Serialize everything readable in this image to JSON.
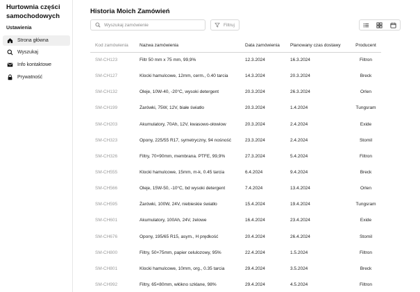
{
  "sidebar": {
    "brand": "Hurtownia części samochodowych",
    "section_label": "Ustawienia",
    "items": [
      {
        "label": "Strona główna",
        "icon": "home-icon",
        "active": true
      },
      {
        "label": "Wyszukaj",
        "icon": "search-icon",
        "active": false
      },
      {
        "label": "Info kontaktowe",
        "icon": "mail-icon",
        "active": false
      },
      {
        "label": "Prywatność",
        "icon": "lock-icon",
        "active": false
      }
    ]
  },
  "header": {
    "title": "Historia Moich Zamówień"
  },
  "search": {
    "placeholder": "Wyszukaj zamówienie",
    "value": ""
  },
  "filter": {
    "label": "Filtruj"
  },
  "view_toggle": [
    "list-view-icon",
    "grid-view-icon",
    "calendar-view-icon"
  ],
  "table": {
    "columns": [
      "Kod zamówienia",
      "Nazwa zamówienia",
      "Data zamówienia",
      "Planowany czas dostawy",
      "Producent"
    ],
    "rows": [
      [
        "SM-CH123",
        "Filtr 50 mm x 75 mm,  99,9%",
        "12.3.2024",
        "16.3.2024",
        "Filtron"
      ],
      [
        "SM-CH127",
        "Klocki hamulcowe, 12mm, cerm., 0.40 tarcia",
        "14.3.2024",
        "20.3.2024",
        "Breck"
      ],
      [
        "SM-CH132",
        "Oleje, 10W-40, -20°C, wysoki detergent",
        "20.3.2024",
        "26.3.2024",
        "Orlen"
      ],
      [
        "SM-CH199",
        "Żarówki, 75W, 12V, białe światło",
        "20.3.2024",
        "1.4.2024",
        "Tungsram"
      ],
      [
        "SM-CH203",
        "Akumulatory, 70Ah, 12V, kwasowo-ołowiow",
        "20.3.2024",
        "2.4.2024",
        "Exide"
      ],
      [
        "SM-CH323",
        "Opony, 225/55 R17, symetryczny, 94 nośność",
        "23.3.2024",
        "2.4.2024",
        "Stomil"
      ],
      [
        "SM-CH326",
        "Filtry, 70×90mm, membrana. PTFE, 99,9%",
        "27.3.2024",
        "5.4.2024",
        "Filtron"
      ],
      [
        "SM-CH555",
        "Klocki hamulcowe, 15mm, m-k, 0.45 tarcia",
        "6.4.2024",
        "9.4.2024",
        "Breck"
      ],
      [
        "SM-CH566",
        "Oleje, 15W-50, -10°C, bd wysoki detergent",
        "7.4.2024",
        "13.4.2024",
        "Orlen"
      ],
      [
        "SM-CH595",
        "Żarówki, 100W, 24V, niebieskie światło",
        "15.4.2024",
        "19.4.2024",
        "Tungsram"
      ],
      [
        "SM-CH601",
        "Akumulatory, 100Ah, 24V, żelowe",
        "16.4.2024",
        "23.4.2024",
        "Exide"
      ],
      [
        "SM-CH676",
        "Opony, 195/65 R15, asym., H prędkość",
        "20.4.2024",
        "26.4.2024",
        "Stomil"
      ],
      [
        "SM-CH800",
        "Filtry, 50×75mm, papier celulozowy, 95%",
        "22.4.2024",
        "1.5.2024",
        "Filtron"
      ],
      [
        "SM-CH801",
        "Klocki hamulcowe, 10mm, org., 0.35 tarcia",
        "29.4.2024",
        "3.5.2024",
        "Breck"
      ],
      [
        "SM-CH992",
        "Filtry, 65×80mm, włókno szklane, 98%",
        "29.4.2024",
        "4.5.2024",
        "Filtron"
      ]
    ]
  }
}
